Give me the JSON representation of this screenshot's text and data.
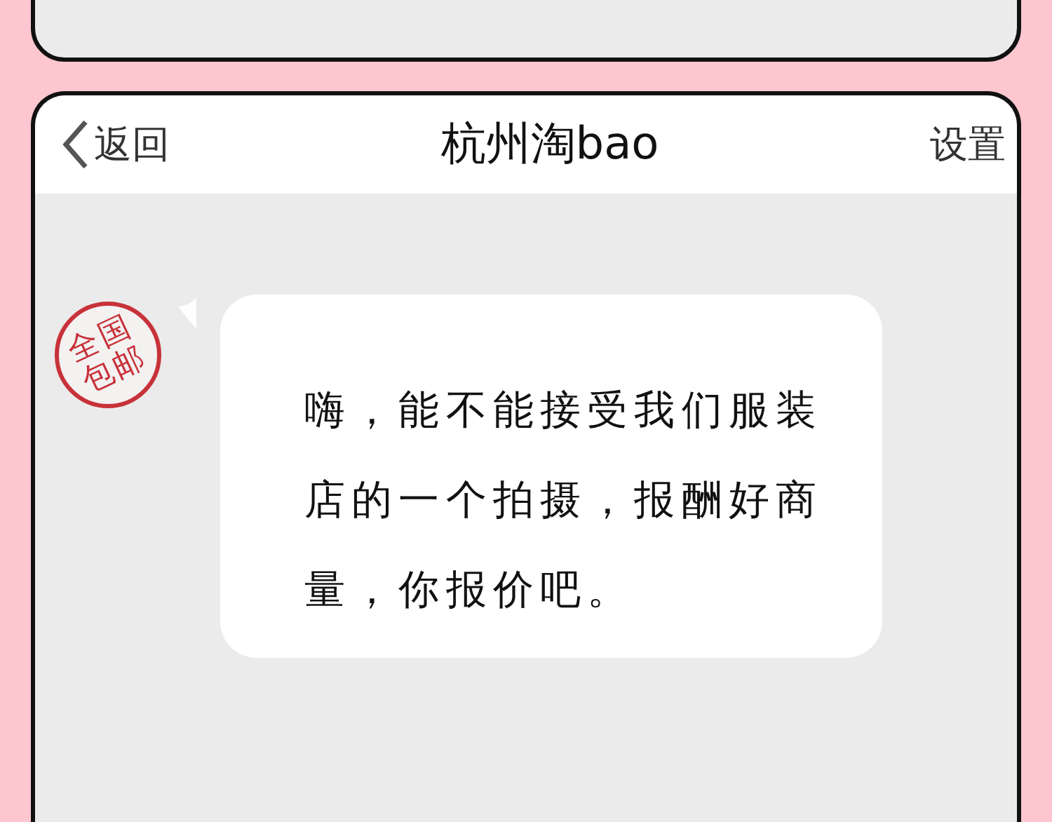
{
  "header": {
    "back": "返回",
    "title": "杭州淘bao",
    "settings": "设置"
  },
  "messages": [
    {
      "avatar_text": "全国包邮",
      "text": "嗨，能不能接受我们服装店的一个拍摄，报酬好商量，你报价吧。"
    }
  ]
}
